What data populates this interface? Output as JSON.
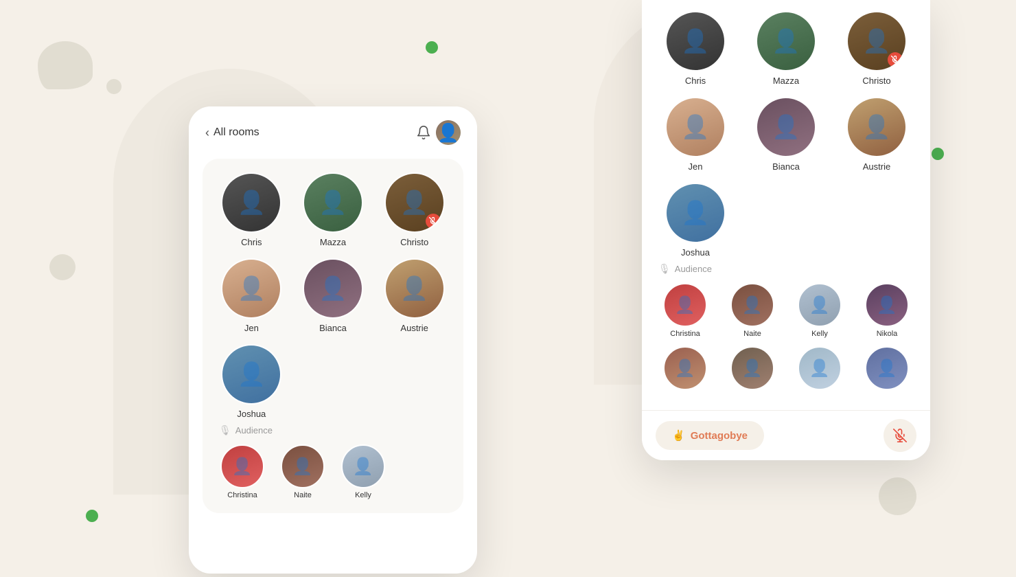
{
  "background": {
    "color": "#f5f0e8"
  },
  "left_phone": {
    "header": {
      "back_label": "All rooms",
      "bell_icon": "bell",
      "avatar_icon": "user-avatar"
    },
    "speakers": [
      {
        "name": "Chris",
        "muted": false,
        "color": "av-chris"
      },
      {
        "name": "Mazza",
        "muted": false,
        "color": "av-mazza"
      },
      {
        "name": "Christo",
        "muted": true,
        "color": "av-christo"
      },
      {
        "name": "Jen",
        "muted": false,
        "color": "av-jen"
      },
      {
        "name": "Bianca",
        "muted": false,
        "color": "av-bianca"
      },
      {
        "name": "Austrie",
        "muted": false,
        "color": "av-austrie"
      },
      {
        "name": "Joshua",
        "muted": false,
        "color": "av-joshua"
      }
    ],
    "audience_label": "Audience",
    "audience": [
      {
        "name": "Christina",
        "color": "av-christina"
      },
      {
        "name": "Naite",
        "color": "av-naite"
      },
      {
        "name": "Kelly",
        "color": "av-kelly"
      }
    ]
  },
  "right_phone": {
    "speakers": [
      {
        "name": "Chris",
        "muted": false,
        "color": "av-chris"
      },
      {
        "name": "Mazza",
        "muted": false,
        "color": "av-mazza"
      },
      {
        "name": "Christo",
        "muted": true,
        "color": "av-christo"
      },
      {
        "name": "Jen",
        "muted": false,
        "color": "av-jen"
      },
      {
        "name": "Bianca",
        "muted": false,
        "color": "av-bianca"
      },
      {
        "name": "Austrie",
        "muted": false,
        "color": "av-austrie"
      },
      {
        "name": "Joshua",
        "muted": false,
        "color": "av-joshua"
      }
    ],
    "audience_label": "Audience",
    "audience": [
      {
        "name": "Christina",
        "color": "av-christina"
      },
      {
        "name": "Naite",
        "color": "av-naite"
      },
      {
        "name": "Kelly",
        "color": "av-kelly"
      },
      {
        "name": "Nikola",
        "color": "av-nikola"
      },
      {
        "name": "",
        "color": "av-user1"
      },
      {
        "name": "",
        "color": "av-user2"
      },
      {
        "name": "",
        "color": "av-user3"
      },
      {
        "name": "",
        "color": "av-user4"
      }
    ],
    "bottom_bar": {
      "gottagobye_label": "Gottagobye",
      "gottagobye_emoji": "✌️",
      "mute_icon": "microphone-muted"
    }
  }
}
